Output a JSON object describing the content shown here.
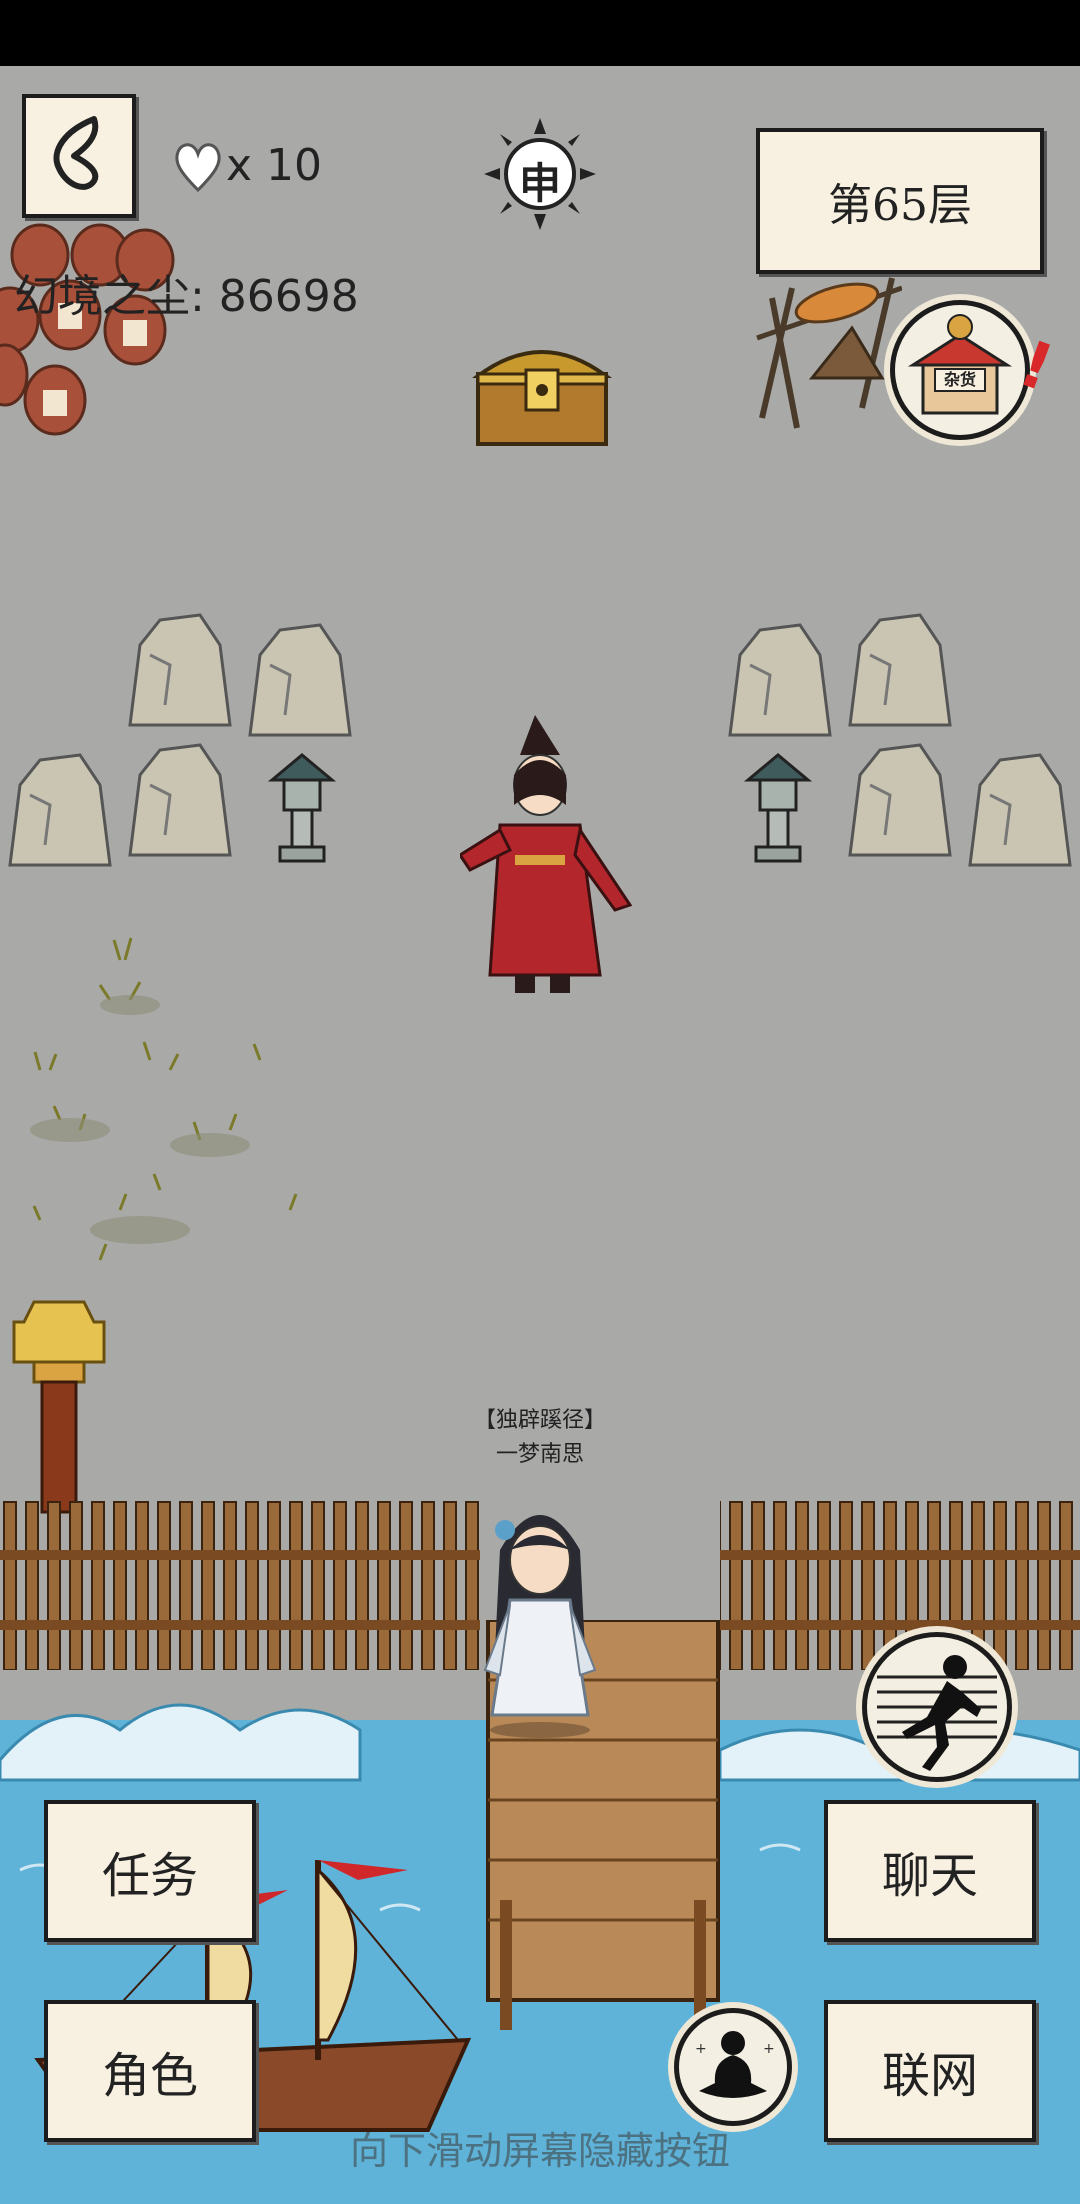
{
  "hud": {
    "lives_count": "x 10",
    "currency_label": "幻境之尘: 86698",
    "time_glyph": "申",
    "floor_label": "第65层",
    "shop_sign": "杂货"
  },
  "npc": {
    "title": "【独辟蹊径】",
    "name": "一梦南思"
  },
  "buttons": {
    "quest": "任务",
    "role": "角色",
    "chat": "聊天",
    "network": "联网"
  },
  "hint": "向下滑动屏幕隐藏按钮",
  "colors": {
    "ground": "#a9aaa8",
    "water": "#5fb3d8",
    "paper": "#f8f1e1",
    "robe_red": "#b3262c",
    "chest_gold": "#c89a2e"
  }
}
